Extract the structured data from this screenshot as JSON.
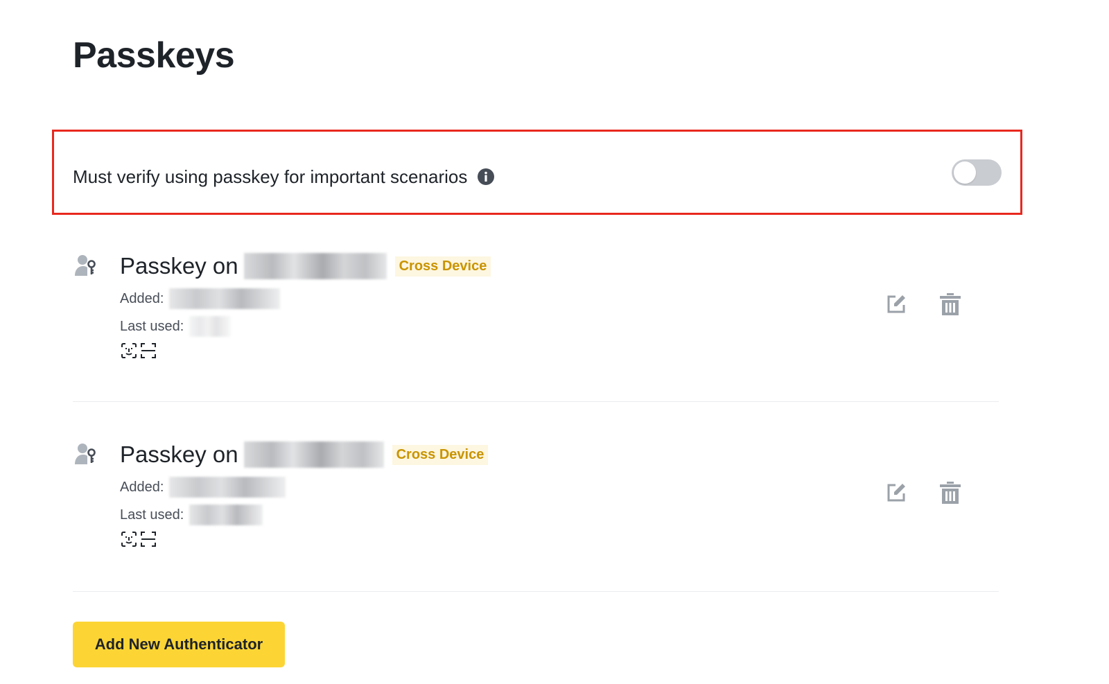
{
  "page": {
    "title": "Passkeys"
  },
  "verify_setting": {
    "label": "Must verify using passkey for important scenarios",
    "enabled": false
  },
  "passkeys": [
    {
      "title_prefix": "Passkey on",
      "badge": "Cross Device",
      "added_label": "Added:",
      "last_used_label": "Last used:"
    },
    {
      "title_prefix": "Passkey on",
      "badge": "Cross Device",
      "added_label": "Added:",
      "last_used_label": "Last used:"
    }
  ],
  "icons": {
    "passkey": "user-key-icon",
    "info": "info-icon",
    "face_id": "face-id-icon",
    "scan": "scan-icon",
    "edit": "edit-icon",
    "delete": "trash-icon"
  },
  "add_button": {
    "label": "Add New Authenticator"
  },
  "colors": {
    "accent": "#fcd535",
    "badge_text": "#c99400",
    "badge_bg": "#fdf6e0",
    "highlight": "#e8281e"
  }
}
